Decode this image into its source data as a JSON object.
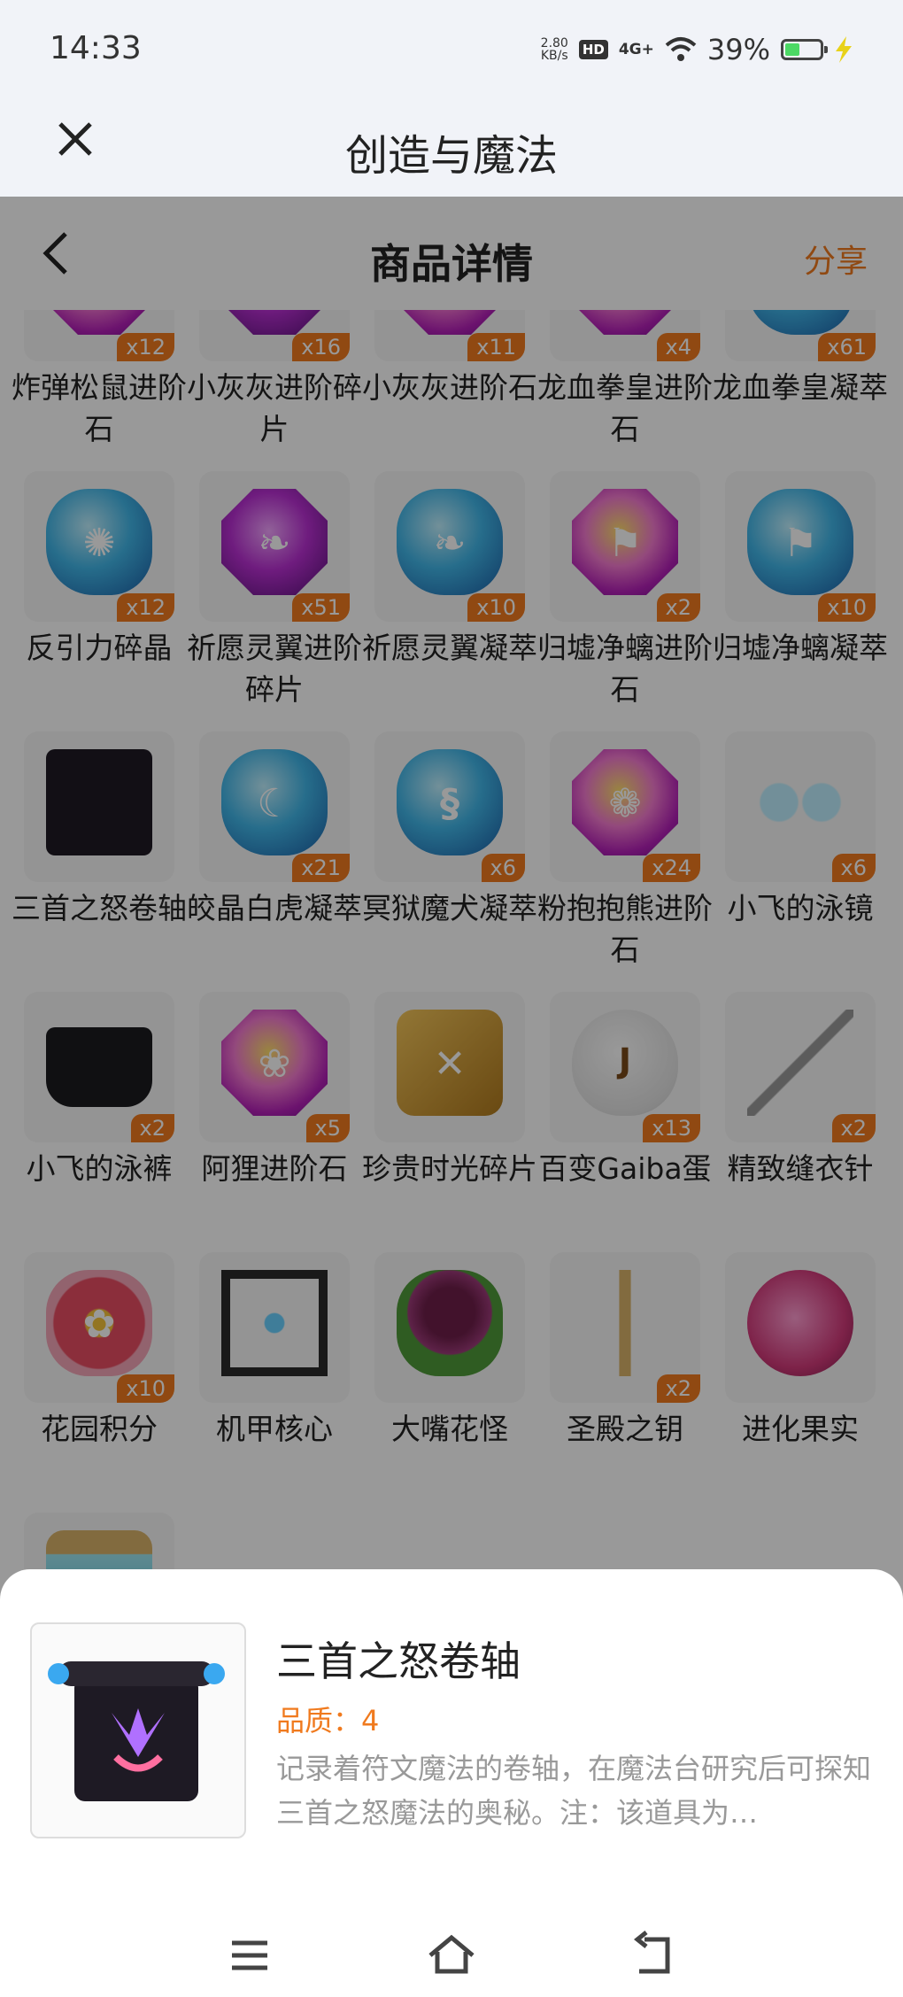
{
  "status": {
    "time": "14:33",
    "net_speed_value": "2.80",
    "net_speed_unit": "KB/s",
    "hd": "HD",
    "signal": "4G+",
    "battery_percent": "39%",
    "battery_level": 0.39
  },
  "app": {
    "title": "创造与魔法"
  },
  "page": {
    "title": "商品详情",
    "share_label": "分享"
  },
  "colors": {
    "accent": "#f07a1e",
    "overlay": "rgba(0,0,0,0.40)"
  },
  "items": [
    {
      "name": "炸弹松鼠进阶石",
      "qty": "x12",
      "icon": "pink-gem-icon",
      "style": "g-pink oct",
      "glyph": "✦"
    },
    {
      "name": "小灰灰进阶碎片",
      "qty": "x16",
      "icon": "purple-gem-icon",
      "style": "g-purple oct",
      "glyph": "◎"
    },
    {
      "name": "小灰灰进阶石",
      "qty": "x11",
      "icon": "pink-gem-icon",
      "style": "g-pink oct",
      "glyph": "◎"
    },
    {
      "name": "龙血拳皇进阶石",
      "qty": "x4",
      "icon": "pink-gem-icon",
      "style": "g-pink oct",
      "glyph": "✧"
    },
    {
      "name": "龙血拳皇凝萃",
      "qty": "x61",
      "icon": "blue-crystal-icon",
      "style": "g-blue",
      "glyph": "✧"
    },
    {
      "name": "反引力碎晶",
      "qty": "x12",
      "icon": "anti-gravity-crystal-icon",
      "style": "g-blue",
      "glyph": "✺"
    },
    {
      "name": "祈愿灵翼进阶碎片",
      "qty": "x51",
      "icon": "purple-gem-icon",
      "style": "g-purple oct",
      "glyph": "❧"
    },
    {
      "name": "祈愿灵翼凝萃",
      "qty": "x10",
      "icon": "blue-crystal-icon",
      "style": "g-blue",
      "glyph": "❧"
    },
    {
      "name": "归墟净螭进阶石",
      "qty": "x2",
      "icon": "pink-gem-icon",
      "style": "g-pink oct",
      "glyph": "⚑"
    },
    {
      "name": "归墟净螭凝萃",
      "qty": "x10",
      "icon": "blue-crystal-icon",
      "style": "g-blue",
      "glyph": "⚑"
    },
    {
      "name": "三首之怒卷轴",
      "qty": "",
      "icon": "scroll-icon",
      "style": "scroll",
      "glyph": ""
    },
    {
      "name": "皎晶白虎凝萃",
      "qty": "x21",
      "icon": "blue-crystal-icon",
      "style": "g-blue",
      "glyph": "☾"
    },
    {
      "name": "冥狱魔犬凝萃",
      "qty": "x6",
      "icon": "blue-crystal-icon",
      "style": "g-blue",
      "glyph": "§"
    },
    {
      "name": "粉抱抱熊进阶石",
      "qty": "x24",
      "icon": "pink-gem-icon",
      "style": "g-pink oct",
      "glyph": "❁"
    },
    {
      "name": "小飞的泳镜",
      "qty": "x6",
      "icon": "goggles-icon",
      "style": "goggles",
      "glyph": ""
    },
    {
      "name": "小飞的泳裤",
      "qty": "x2",
      "icon": "swim-trunks-icon",
      "style": "trunks",
      "glyph": ""
    },
    {
      "name": "阿狸进阶石",
      "qty": "x5",
      "icon": "pink-gem-icon",
      "style": "g-pink oct",
      "glyph": "❀"
    },
    {
      "name": "珍贵时光碎片",
      "qty": "",
      "icon": "time-fragment-icon",
      "style": "fragment",
      "glyph": "✕"
    },
    {
      "name": "百变Gaiba蛋",
      "qty": "x13",
      "icon": "egg-icon",
      "style": "egg",
      "glyph": "J"
    },
    {
      "name": "精致缝衣针",
      "qty": "x2",
      "icon": "needle-icon",
      "style": "needle",
      "glyph": ""
    },
    {
      "name": "花园积分",
      "qty": "x10",
      "icon": "flower-icon",
      "style": "flower",
      "glyph": "✿"
    },
    {
      "name": "机甲核心",
      "qty": "",
      "icon": "mecha-core-icon",
      "style": "cube",
      "glyph": ""
    },
    {
      "name": "大嘴花怪",
      "qty": "",
      "icon": "piranha-plant-icon",
      "style": "plant",
      "glyph": ""
    },
    {
      "name": "圣殿之钥",
      "qty": "x2",
      "icon": "key-icon",
      "style": "key",
      "glyph": ""
    },
    {
      "name": "进化果实",
      "qty": "",
      "icon": "fruit-icon",
      "style": "fruit",
      "glyph": ""
    },
    {
      "name": "",
      "qty": "",
      "icon": "potion-icon",
      "style": "potion",
      "glyph": ""
    }
  ],
  "detail": {
    "name": "三首之怒卷轴",
    "quality": "品质：4",
    "description": "记录着符文魔法的卷轴，在魔法台研究后可探知三首之怒魔法的奥秘。注：该道具为…"
  }
}
